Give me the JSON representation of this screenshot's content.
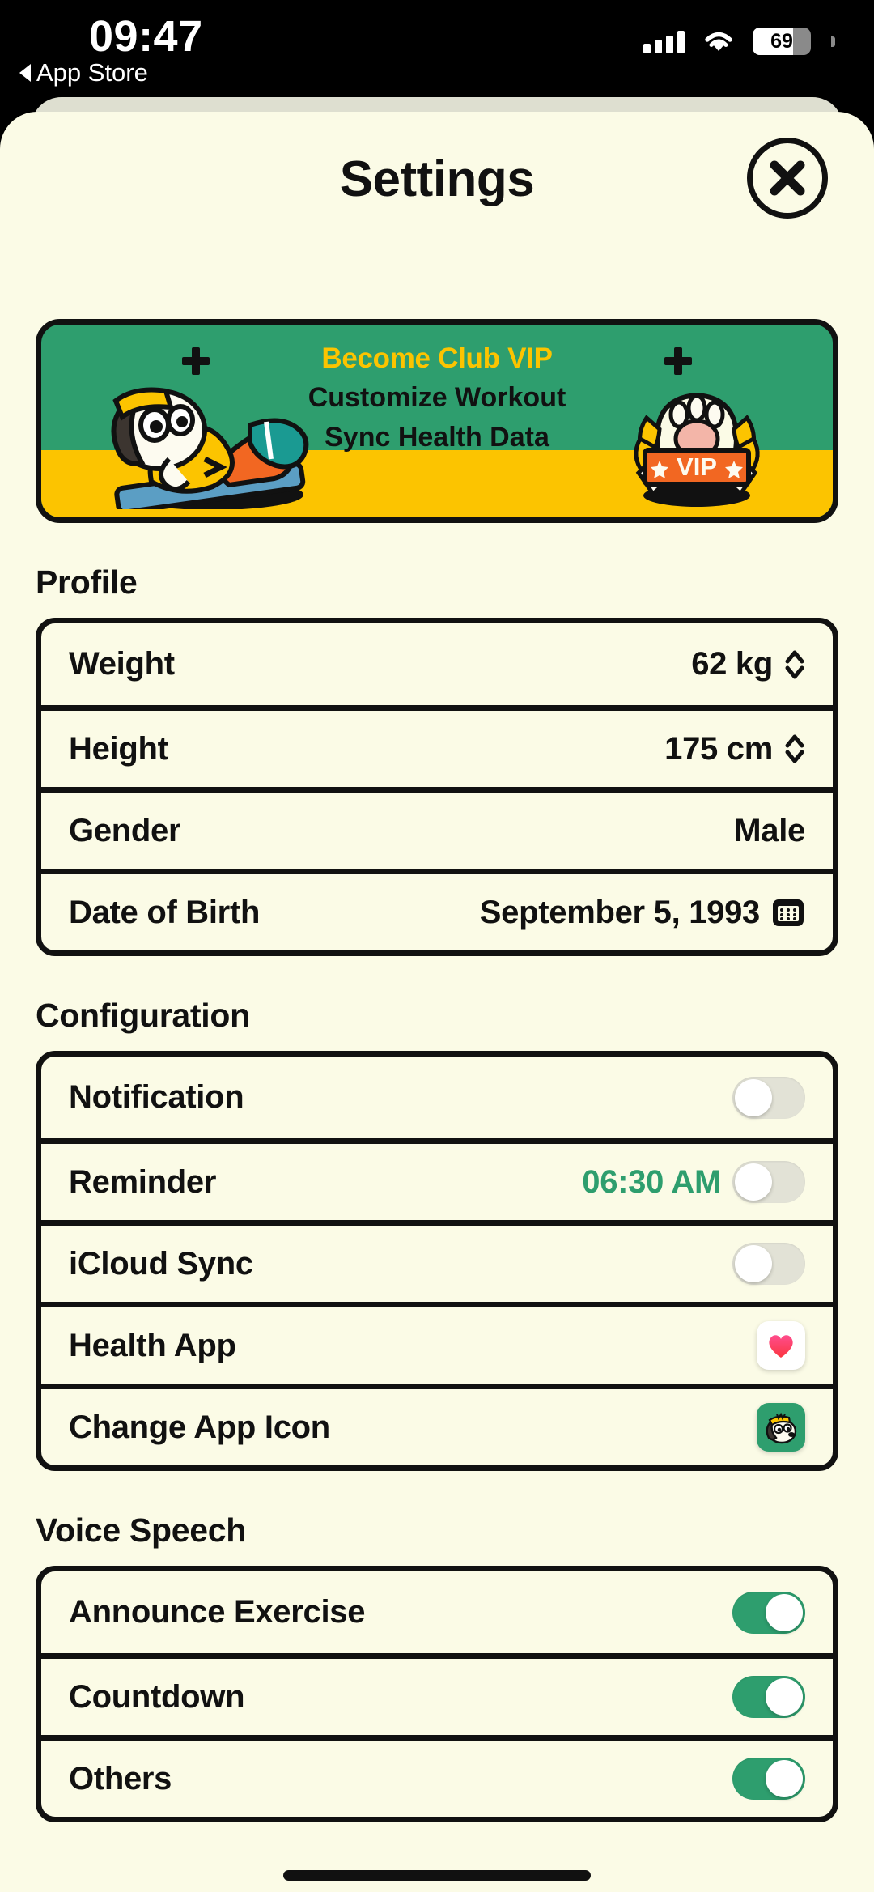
{
  "status_bar": {
    "time": "09:47",
    "back_label": "App Store",
    "battery_percent": "69",
    "signal_icon": "signal-bars-icon",
    "wifi_icon": "wifi-icon",
    "battery_icon": "battery-icon"
  },
  "header": {
    "title": "Settings",
    "close_icon": "close-x-icon"
  },
  "promo_banner": {
    "headline": "Become Club VIP",
    "benefit_line_1": "Customize Workout",
    "benefit_line_2": "Sync Health Data",
    "badge_label": "VIP",
    "headline_color": "#fcc400",
    "background_color": "#2e9e6e",
    "ground_color": "#fcc400"
  },
  "sections": [
    {
      "title": "Profile",
      "rows": [
        {
          "label": "Weight",
          "value": "62 kg",
          "accessory": "stepper-icon"
        },
        {
          "label": "Height",
          "value": "175 cm",
          "accessory": "stepper-icon"
        },
        {
          "label": "Gender",
          "value": "Male",
          "accessory": "none"
        },
        {
          "label": "Date of Birth",
          "value": "September 5, 1993",
          "accessory": "calendar-icon"
        }
      ]
    },
    {
      "title": "Configuration",
      "rows": [
        {
          "label": "Notification",
          "value": "",
          "accessory": "toggle",
          "toggle_state": "off"
        },
        {
          "label": "Reminder",
          "value": "06:30 AM",
          "accessory": "toggle",
          "toggle_state": "off",
          "value_color": "#2e9e6e"
        },
        {
          "label": "iCloud Sync",
          "value": "",
          "accessory": "toggle",
          "toggle_state": "off"
        },
        {
          "label": "Health App",
          "value": "",
          "accessory": "health-heart-icon"
        },
        {
          "label": "Change App Icon",
          "value": "",
          "accessory": "app-icon-dog"
        }
      ]
    },
    {
      "title": "Voice Speech",
      "rows": [
        {
          "label": "Announce Exercise",
          "value": "",
          "accessory": "toggle",
          "toggle_state": "on"
        },
        {
          "label": "Countdown",
          "value": "",
          "accessory": "toggle",
          "toggle_state": "on"
        },
        {
          "label": "Others",
          "value": "",
          "accessory": "toggle",
          "toggle_state": "on"
        }
      ]
    }
  ],
  "colors": {
    "sheet_background": "#fbfbe6",
    "ink": "#111111",
    "accent_green": "#2e9e6e",
    "accent_yellow": "#fcc400",
    "toggle_off": "#e2e2d6"
  }
}
